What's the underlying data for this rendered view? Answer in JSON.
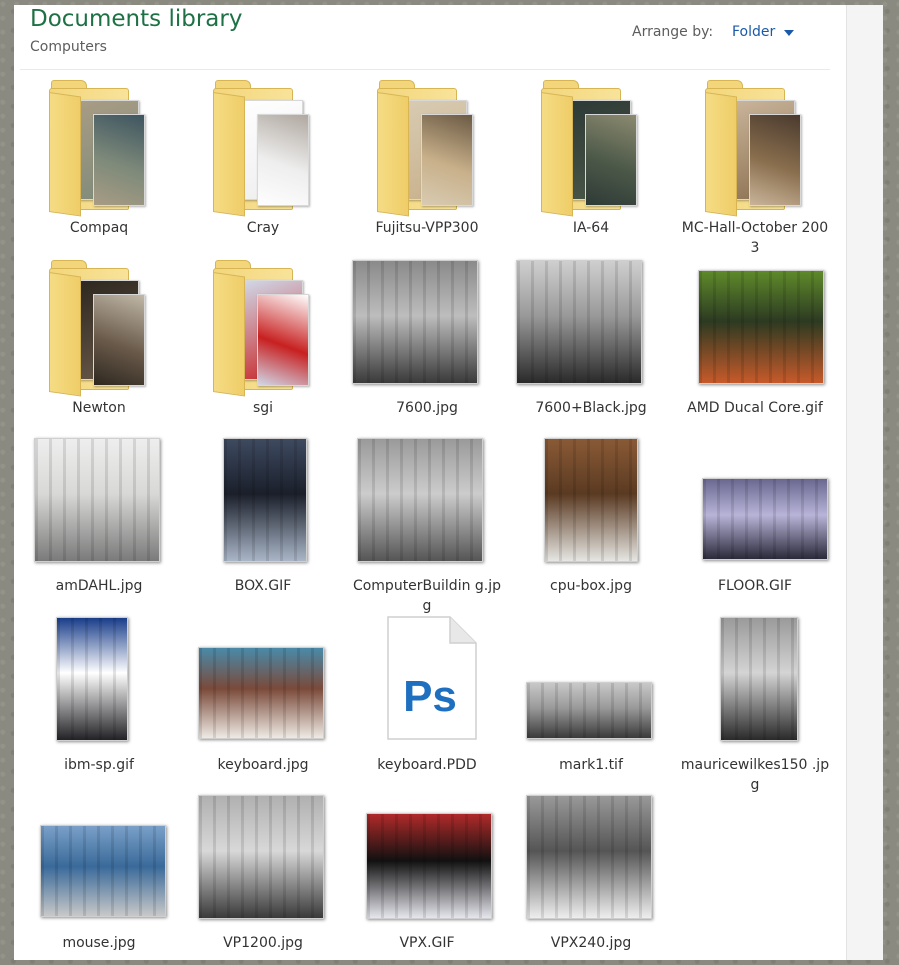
{
  "header": {
    "title": "Documents library",
    "subtitle": "Computers",
    "arrange_label": "Arrange by:",
    "arrange_value": "Folder"
  },
  "items": [
    {
      "label": "Compaq",
      "kind": "folder",
      "colors": [
        "#7e8a7a",
        "#3e5560",
        "#a89c84"
      ]
    },
    {
      "label": "Cray",
      "kind": "folder",
      "colors": [
        "#eeeeee",
        "#b0a8a0",
        "#fefefe"
      ]
    },
    {
      "label": "Fujitsu-VPP300",
      "kind": "folder",
      "colors": [
        "#c8b08a",
        "#6b5a44",
        "#d8cbb2"
      ]
    },
    {
      "label": "IA-64",
      "kind": "folder",
      "colors": [
        "#4b5848",
        "#8c8a70",
        "#2e3a36"
      ]
    },
    {
      "label": "MC-Hall-October 2003",
      "kind": "folder",
      "colors": [
        "#8a6f4e",
        "#4a3a2e",
        "#c9b49a"
      ]
    },
    {
      "label": "Newton",
      "kind": "folder",
      "colors": [
        "#6a5a4a",
        "#c0b8a8",
        "#2e2820"
      ]
    },
    {
      "label": "sgi",
      "kind": "folder",
      "colors": [
        "#c82020",
        "#ffffff",
        "#d0d8e8"
      ]
    },
    {
      "label": "7600.jpg",
      "kind": "image",
      "colors": [
        "#bdbdbd",
        "#3a3a3a",
        "#8a8a8a"
      ]
    },
    {
      "label": "7600+Black.jpg",
      "kind": "image",
      "colors": [
        "#999999",
        "#2a2a2a",
        "#cfcfcf"
      ]
    },
    {
      "label": "AMD Ducal Core.gif",
      "kind": "image",
      "colors": [
        "#2c3a22",
        "#c75a2a",
        "#5f8a2a"
      ]
    },
    {
      "label": "amDAHL.jpg",
      "kind": "image",
      "colors": [
        "#d8d8d6",
        "#7a7a7a",
        "#eeeeee"
      ]
    },
    {
      "label": "BOX.GIF",
      "kind": "image",
      "colors": [
        "#1a1f2a",
        "#aab6c8",
        "#3e4a60"
      ]
    },
    {
      "label": "ComputerBuildin g.jpg",
      "kind": "image",
      "colors": [
        "#cccccc",
        "#555555",
        "#9a9a9a"
      ]
    },
    {
      "label": "cpu-box.jpg",
      "kind": "image",
      "colors": [
        "#5a3a22",
        "#e6e6e2",
        "#8a5a36"
      ]
    },
    {
      "label": "FLOOR.GIF",
      "kind": "image",
      "colors": [
        "#b8b4d8",
        "#2a2a3a",
        "#6a6890"
      ]
    },
    {
      "label": "ibm-sp.gif",
      "kind": "image",
      "colors": [
        "#ffffff",
        "#222226",
        "#1a3e8a"
      ]
    },
    {
      "label": "keyboard.jpg",
      "kind": "image",
      "colors": [
        "#7a4a3a",
        "#eeeae4",
        "#4a8aa8"
      ]
    },
    {
      "label": "keyboard.PDD",
      "kind": "psd",
      "colors": [
        "#ffffff",
        "#1e6fc0",
        "#e8e8e8"
      ]
    },
    {
      "label": "mark1.tif",
      "kind": "image",
      "colors": [
        "#9a9a9a",
        "#3a3a3a",
        "#c8c8c8"
      ]
    },
    {
      "label": "mauricewilkes150 .jpg",
      "kind": "image",
      "colors": [
        "#d4d4d4",
        "#2a2a2a",
        "#9a9a9a"
      ]
    },
    {
      "label": "mouse.jpg",
      "kind": "image",
      "colors": [
        "#3a6a9a",
        "#c8c8c8",
        "#7aa0c8"
      ]
    },
    {
      "label": "VP1200.jpg",
      "kind": "image",
      "colors": [
        "#d8d8d8",
        "#3a3a3a",
        "#b0b0b0"
      ]
    },
    {
      "label": "VPX.GIF",
      "kind": "image",
      "colors": [
        "#111111",
        "#e6e6ee",
        "#b02a2a"
      ]
    },
    {
      "label": "VPX240.jpg",
      "kind": "image",
      "colors": [
        "#555555",
        "#eeeeee",
        "#999999"
      ]
    }
  ]
}
